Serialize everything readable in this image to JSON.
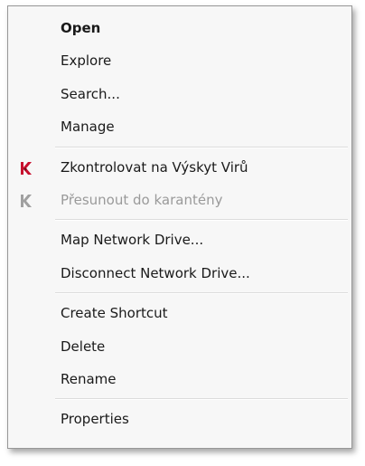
{
  "menu": {
    "items": [
      {
        "label": "Open",
        "bold": true,
        "disabled": false
      },
      {
        "label": "Explore",
        "bold": false,
        "disabled": false
      },
      {
        "label": "Search...",
        "bold": false,
        "disabled": false
      },
      {
        "label": "Manage",
        "bold": false,
        "disabled": false
      },
      {
        "label": "Zkontrolovat na Výskyt Virů",
        "bold": false,
        "disabled": false,
        "icon": "kaspersky-icon"
      },
      {
        "label": "Přesunout do karantény",
        "bold": false,
        "disabled": true,
        "icon": "kaspersky-icon"
      },
      {
        "label": "Map Network Drive...",
        "bold": false,
        "disabled": false
      },
      {
        "label": "Disconnect Network Drive...",
        "bold": false,
        "disabled": false
      },
      {
        "label": "Create Shortcut",
        "bold": false,
        "disabled": false
      },
      {
        "label": "Delete",
        "bold": false,
        "disabled": false
      },
      {
        "label": "Rename",
        "bold": false,
        "disabled": false
      },
      {
        "label": "Properties",
        "bold": false,
        "disabled": false
      }
    ]
  },
  "colors": {
    "kaspersky_red": "#c8102e",
    "kaspersky_disabled": "#a0a0a0",
    "disabled_text": "#9a9a9a"
  }
}
